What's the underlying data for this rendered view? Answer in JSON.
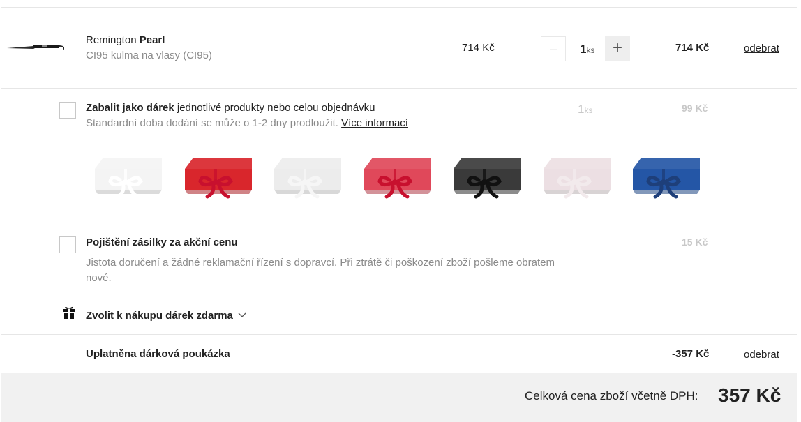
{
  "product": {
    "brand": "Remington",
    "model": "Pearl",
    "subtitle": "CI95 kulma na vlasy (CI95)",
    "unit_price": "714 Kč",
    "qty": "1",
    "qty_unit": "ks",
    "total": "714 Kč",
    "remove_label": "odebrat",
    "minus_symbol": "–",
    "plus_symbol": "+"
  },
  "gift_wrap": {
    "title_bold": "Zabalit jako dárek",
    "title_rest": " jednotlivé produkty nebo celou objednávku",
    "note": "Standardní doba dodání se může o 1-2 dny prodloužit. ",
    "more_info": "Více informací",
    "qty": "1",
    "qty_unit": "ks",
    "price": "99 Kč",
    "boxes": [
      {
        "name": "white-stars",
        "color": "#f4f4f4",
        "ribbon": "#ffffff"
      },
      {
        "name": "red-stars",
        "color": "#d9262c",
        "ribbon": "#c8102e"
      },
      {
        "name": "white-quilted",
        "color": "#ececec",
        "ribbon": "#f6f6f6"
      },
      {
        "name": "red-quilted",
        "color": "#e0485a",
        "ribbon": "#c8102e"
      },
      {
        "name": "black",
        "color": "#3a3a3a",
        "ribbon": "#111111"
      },
      {
        "name": "pink-white",
        "color": "#ecdfe3",
        "ribbon": "#f2eaec"
      },
      {
        "name": "blue",
        "color": "#2456a6",
        "ribbon": "#1e3f7a"
      }
    ]
  },
  "insurance": {
    "title": "Pojištění zásilky za akční cenu",
    "desc": "Jistota doručení a žádné reklamační řízení s dopravcí. Při ztrátě či poškození zboží pošleme obratem nové.",
    "price": "15 Kč"
  },
  "free_gift": {
    "label": "Zvolit k nákupu dárek zdarma"
  },
  "voucher": {
    "label": "Uplatněna dárková poukázka",
    "amount": "-357 Kč",
    "remove_label": "odebrat"
  },
  "summary": {
    "label": "Celková cena zboží včetně DPH:",
    "total": "357 Kč"
  }
}
